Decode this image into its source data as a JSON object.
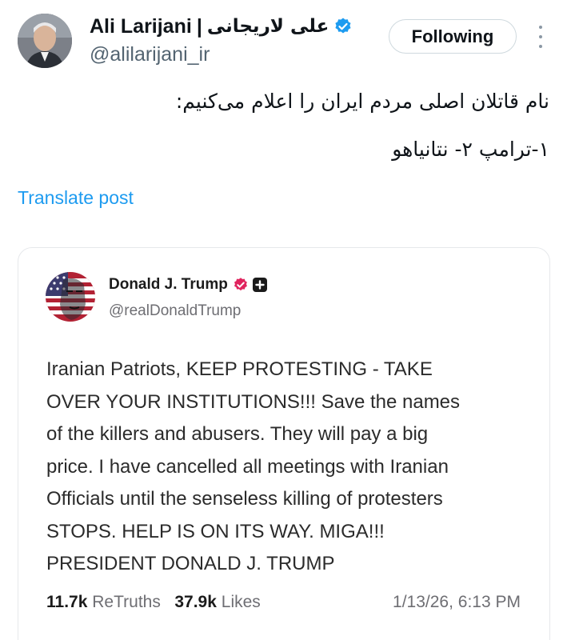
{
  "post": {
    "author_name": "Ali Larijani",
    "name_separator": "|",
    "author_name_fa": "علی لاریجانی",
    "handle": "@alilarijani_ir",
    "follow_label": "Following",
    "text_line_1": "نام قاتلان اصلی مردم ایران را اعلام می‌کنیم:",
    "text_line_2": "۱-ترامپ ۲- نتانیاهو",
    "translate_label": "Translate post",
    "verified_color": "#1d9bf0"
  },
  "quoted": {
    "author_name": "Donald J. Trump",
    "handle": "@realDonaldTrump",
    "badge_color": "#e0245e",
    "body_lines": [
      "Iranian Patriots, KEEP PROTESTING - TAKE",
      "OVER YOUR INSTITUTIONS!!! Save the names",
      "of the killers and abusers. They will pay a big",
      "price. I have cancelled all meetings with Iranian",
      "Officials until the senseless killing of protesters",
      "STOPS. HELP IS ON ITS WAY. MIGA!!!",
      "PRESIDENT DONALD J. TRUMP"
    ],
    "retruths_count": "11.7k",
    "retruths_label": "ReTruths",
    "likes_count": "37.9k",
    "likes_label": "Likes",
    "timestamp": "1/13/26, 6:13 PM"
  }
}
